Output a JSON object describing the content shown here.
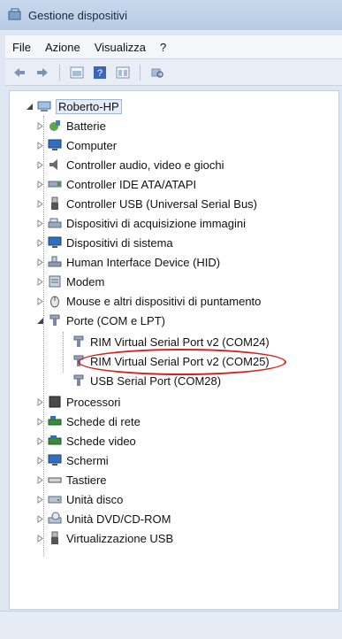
{
  "window": {
    "title": "Gestione dispositivi"
  },
  "menu": [
    "File",
    "Azione",
    "Visualizza",
    "?"
  ],
  "toolbar": {
    "buttons": [
      "back-arrow-icon",
      "forward-arrow-icon",
      "properties-icon",
      "help-icon",
      "view-icon",
      "scan-hardware-icon"
    ]
  },
  "tree": {
    "root": "Roberto-HP",
    "items": [
      {
        "label": "Batterie",
        "icon": "battery-icon"
      },
      {
        "label": "Computer",
        "icon": "computer-icon"
      },
      {
        "label": "Controller audio, video e giochi",
        "icon": "speaker-icon"
      },
      {
        "label": "Controller IDE ATA/ATAPI",
        "icon": "ide-controller-icon"
      },
      {
        "label": "Controller USB (Universal Serial Bus)",
        "icon": "usb-icon"
      },
      {
        "label": "Dispositivi di acquisizione immagini",
        "icon": "scanner-icon"
      },
      {
        "label": "Dispositivi di sistema",
        "icon": "system-device-icon"
      },
      {
        "label": "Human Interface Device (HID)",
        "icon": "hid-icon"
      },
      {
        "label": "Modem",
        "icon": "modem-icon"
      },
      {
        "label": "Mouse e altri dispositivi di puntamento",
        "icon": "mouse-icon"
      },
      {
        "label": "Porte (COM e LPT)",
        "icon": "port-icon",
        "expanded": true,
        "children": [
          {
            "label": "RIM Virtual Serial Port v2 (COM24)",
            "icon": "port-icon"
          },
          {
            "label": "RIM Virtual Serial Port v2 (COM25)",
            "icon": "port-icon"
          },
          {
            "label": "USB Serial Port (COM28)",
            "icon": "port-icon",
            "highlighted": true
          }
        ]
      },
      {
        "label": "Processori",
        "icon": "processor-icon"
      },
      {
        "label": "Schede di rete",
        "icon": "network-icon"
      },
      {
        "label": "Schede video",
        "icon": "display-adapter-icon"
      },
      {
        "label": "Schermi",
        "icon": "monitor-icon"
      },
      {
        "label": "Tastiere",
        "icon": "keyboard-icon"
      },
      {
        "label": "Unità disco",
        "icon": "disk-drive-icon"
      },
      {
        "label": "Unità DVD/CD-ROM",
        "icon": "dvd-icon"
      },
      {
        "label": "Virtualizzazione USB",
        "icon": "usb-icon"
      }
    ]
  },
  "colors": {
    "highlight": "#d5221f"
  }
}
